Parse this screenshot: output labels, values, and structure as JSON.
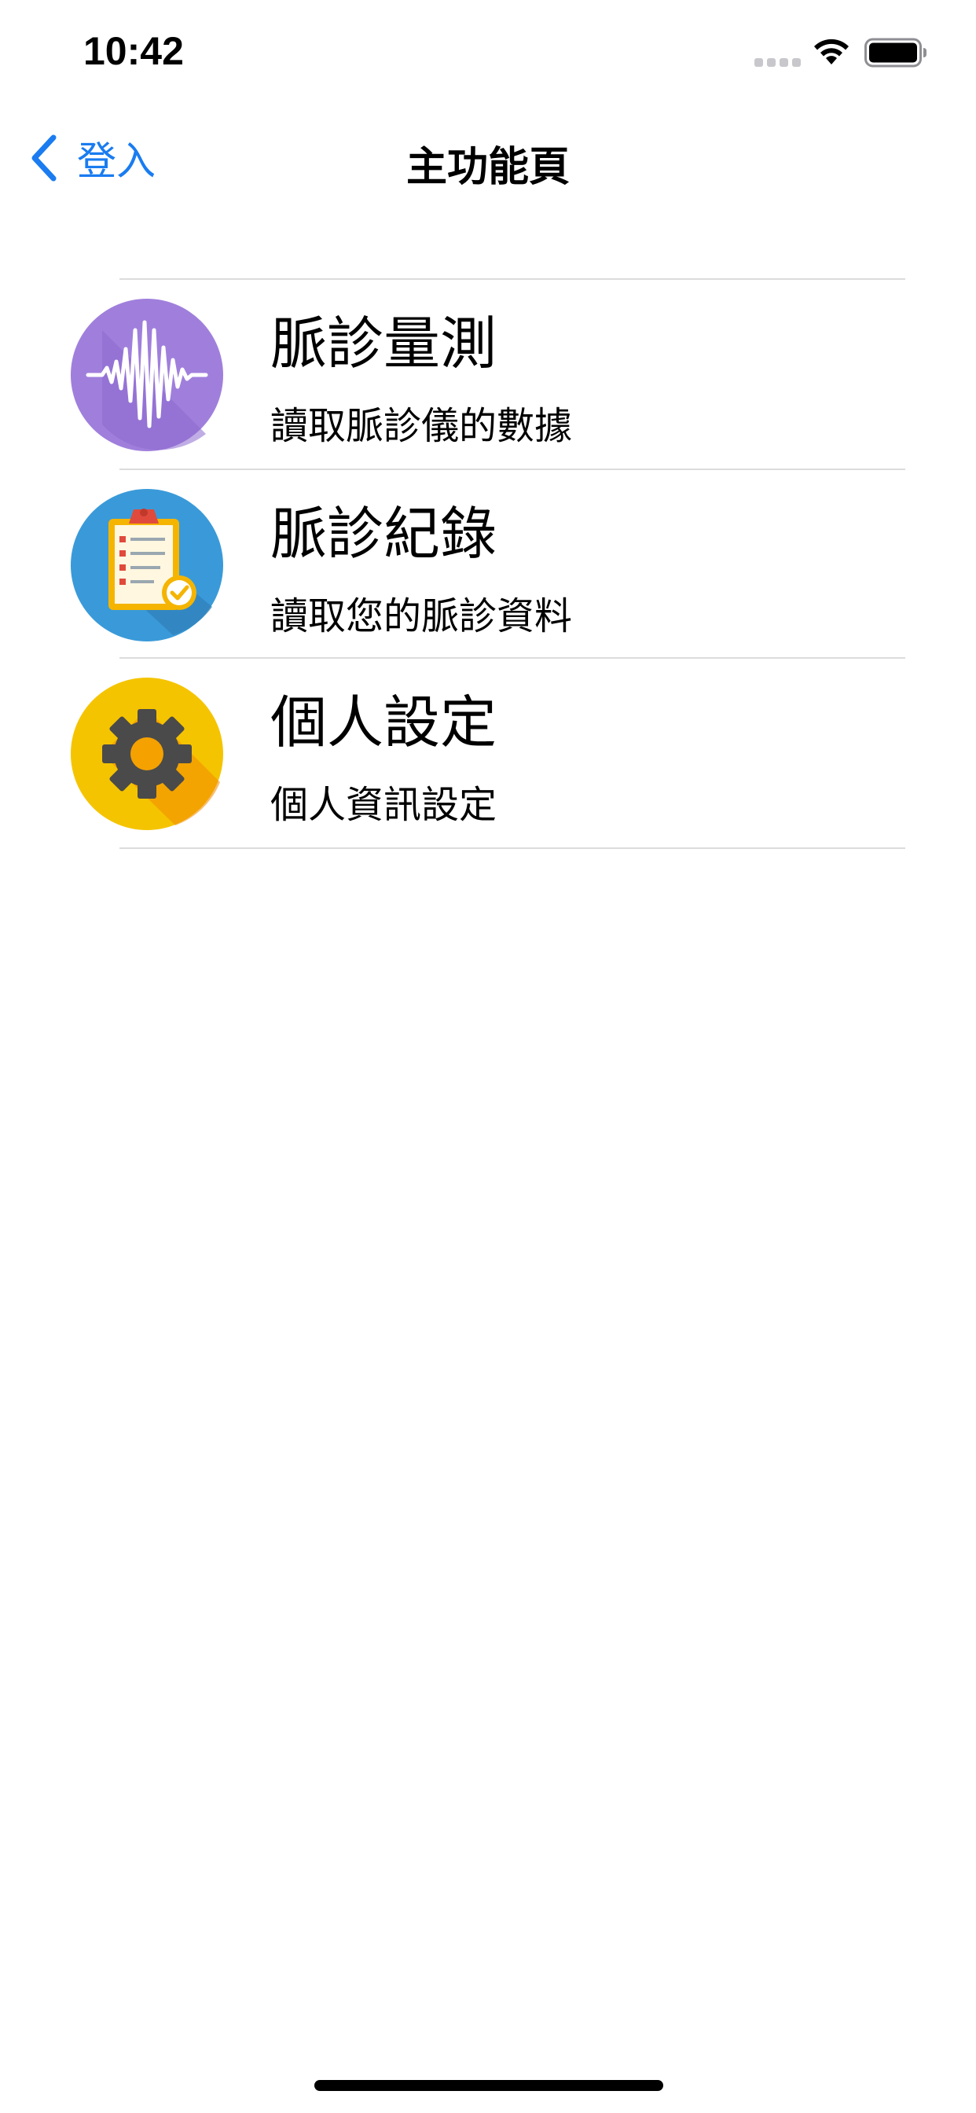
{
  "status_bar": {
    "time": "10:42"
  },
  "nav": {
    "back_label": "登入",
    "title": "主功能頁"
  },
  "menu": {
    "items": [
      {
        "title": "脈診量測",
        "subtitle": "讀取脈診儀的數據",
        "icon": "pulse-waveform-icon",
        "icon_color": "#a07fdc"
      },
      {
        "title": "脈診紀錄",
        "subtitle": "讀取您的脈診資料",
        "icon": "clipboard-checklist-icon",
        "icon_color": "#3a9ad9"
      },
      {
        "title": "個人設定",
        "subtitle": "個人資訊設定",
        "icon": "gear-icon",
        "icon_color": "#f5c400"
      }
    ]
  },
  "colors": {
    "accent": "#1a7cf0",
    "separator": "#dcdcdc",
    "text": "#000000"
  }
}
